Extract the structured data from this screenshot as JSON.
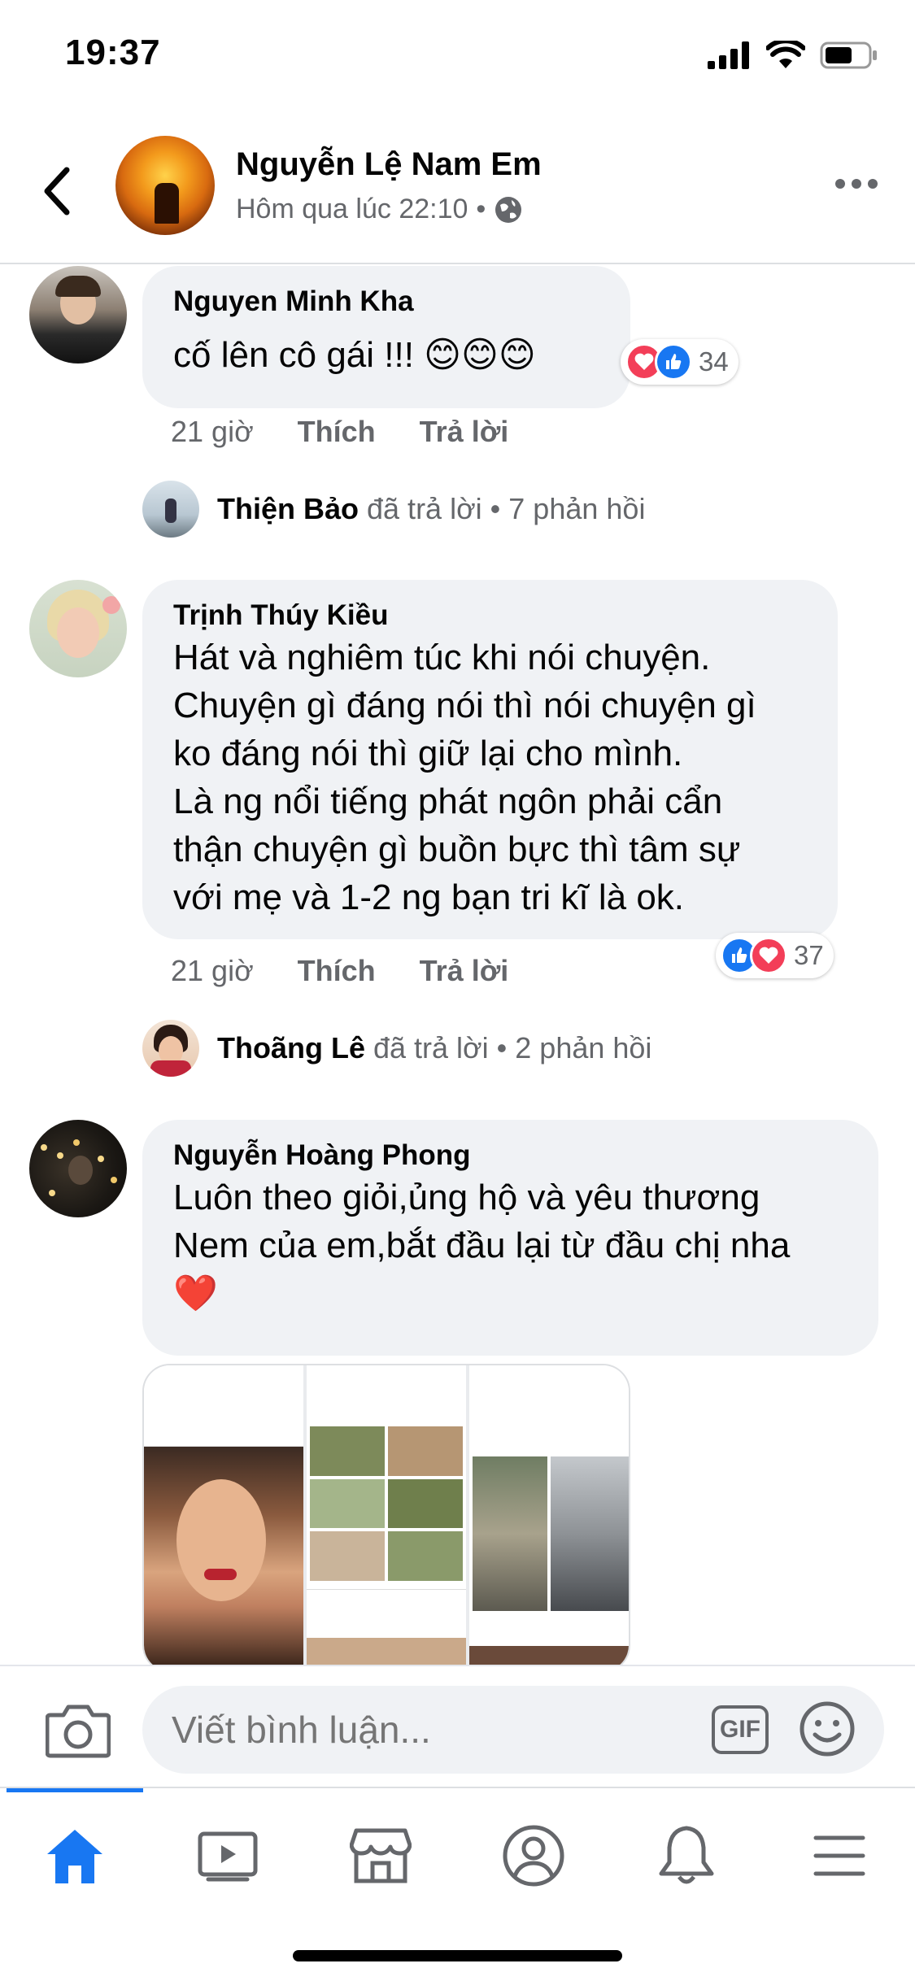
{
  "status_bar": {
    "time": "19:37"
  },
  "header": {
    "page_name": "Nguyễn Lệ Nam Em",
    "timestamp": "Hôm qua lúc 22:10",
    "separator": "•"
  },
  "comments": [
    {
      "author": "Nguyen Minh Kha",
      "text": "cố lên cô gái !!! 😊😊😊",
      "time": "21 giờ",
      "like_label": "Thích",
      "reply_label": "Trả lời",
      "reaction_count": "34",
      "reply_summary": {
        "name": "Thiện Bảo",
        "text": "đã trả lời • 7 phản hồi"
      }
    },
    {
      "author": "Trịnh Thúy Kiều",
      "text": "Hát và nghiêm túc khi nói chuyện.\nChuyện gì đáng nói thì nói chuyện gì\nko đáng nói thì giữ lại cho mình.\nLà ng nổi tiếng phát ngôn phải cẩn\nthận chuyện gì buồn bực thì tâm sự\nvới mẹ và 1-2 ng bạn tri kĩ là ok.",
      "time": "21 giờ",
      "like_label": "Thích",
      "reply_label": "Trả lời",
      "reaction_count": "37",
      "reply_summary": {
        "name": "Thoãng Lê",
        "text": "đã trả lời • 2 phản hồi"
      }
    },
    {
      "author": "Nguyễn Hoàng Phong",
      "text": "Luôn theo giỏi,ủng hộ và yêu thương\nNem của em,bắt đầu lại từ đầu chị nha\n❤️"
    }
  ],
  "composer": {
    "placeholder": "Viết bình luận...",
    "gif_label": "GIF"
  },
  "tabs": [
    {
      "icon": "home-icon",
      "active": true
    },
    {
      "icon": "watch-icon",
      "active": false
    },
    {
      "icon": "marketplace-icon",
      "active": false
    },
    {
      "icon": "profile-icon",
      "active": false
    },
    {
      "icon": "notifications-icon",
      "active": false
    },
    {
      "icon": "menu-icon",
      "active": false
    }
  ],
  "colors": {
    "accent": "#1877f2",
    "love": "#f33e58",
    "bubble": "#f0f2f5",
    "secondary_text": "#65676b"
  }
}
